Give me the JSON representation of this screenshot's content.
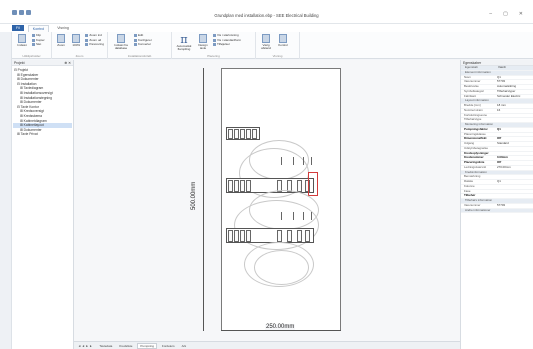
{
  "window": {
    "title": "Grundplan med installation.ebp - SEE Electrical Building",
    "controls": [
      "–",
      "▢",
      "✕"
    ]
  },
  "ribbon_tabs": [
    {
      "label": "Fil"
    },
    {
      "label": "Kontrol"
    },
    {
      "label": "Visning"
    }
  ],
  "ribbon": {
    "groups": [
      {
        "label": "Udklipsholder",
        "items": [
          "Klip",
          "Kopier",
          "Indsæt",
          "Slet"
        ]
      },
      {
        "label": "Zoom",
        "items": [
          "Zoom",
          "100%",
          "Zoom ind",
          "Zoom ud",
          "Panorering"
        ]
      },
      {
        "label": "Installationsforløb",
        "items": [
          "Indsæt fra database",
          "Edit",
          "Konfigurer",
          "Konverter"
        ]
      },
      {
        "label": "Placering",
        "items": [
          "Automatisk flampiling",
          "Design tavle",
          "Tilføjelser"
        ]
      },
      {
        "label": "Visning",
        "items": [
          "Vis i startvisning",
          "Vis i standardform",
          "Vis i Isometrisk",
          "Vælg afstand",
          "Kontrol"
        ]
      }
    ]
  },
  "nav": {
    "title": "Projekt",
    "pin": "⊕ ✕",
    "items": [
      {
        "label": "⊟ Projekt",
        "indent": 0
      },
      {
        "label": "⊞ Egenskaber",
        "indent": 1
      },
      {
        "label": "⊞ Dokumenter",
        "indent": 1
      },
      {
        "label": "⊟ Installation",
        "indent": 1
      },
      {
        "label": "⊞ Tavlediagram",
        "indent": 2
      },
      {
        "label": "⊞ Installationsoversigt",
        "indent": 2
      },
      {
        "label": "⊞ Installationstegning",
        "indent": 2
      },
      {
        "label": "⊞ Dokumenter",
        "indent": 2
      },
      {
        "label": "⊟ Tavle Kontor",
        "indent": 1
      },
      {
        "label": "⊞ Kredsoversigt",
        "indent": 2
      },
      {
        "label": "⊞ Kredsskema",
        "indent": 2
      },
      {
        "label": "⊞ Kabinetdiagram",
        "indent": 2
      },
      {
        "label": "⊞ Kabinetlayout",
        "indent": 2,
        "selected": true
      },
      {
        "label": "⊞ Dokumenter",
        "indent": 2
      },
      {
        "label": "⊞ Tavle Privat",
        "indent": 1
      }
    ]
  },
  "drawing": {
    "vertical_dim": "500.00mm",
    "horizontal_dim": "250.00mm"
  },
  "sheet_tabs": [
    {
      "label": "◄ ◄ ► ►"
    },
    {
      "label": "Tavledata"
    },
    {
      "label": "Kredsliste"
    },
    {
      "label": "Pumpning"
    },
    {
      "label": "Fordelers"
    },
    {
      "label": "Ark"
    }
  ],
  "props": {
    "title": "Egenskaber",
    "rows": [
      {
        "k": "Egenskab",
        "v": "Værdi",
        "type": "section"
      },
      {
        "k": "Element information",
        "v": "",
        "type": "section"
      },
      {
        "k": "Navn",
        "v": "Q1",
        "type": ""
      },
      {
        "k": "Varenummer",
        "v": "57703",
        "type": ""
      },
      {
        "k": "Beskrivelse",
        "v": "Automatsikring",
        "type": ""
      },
      {
        "k": "Symbolkategori",
        "v": "Tilbehørstyper",
        "type": ""
      },
      {
        "k": "Fabrikant",
        "v": "Schneider Electric",
        "type": ""
      },
      {
        "k": "Layout information",
        "v": "",
        "type": "section"
      },
      {
        "k": "Bredde [mm]",
        "v": "18 mm",
        "type": ""
      },
      {
        "k": "Nominel strøm",
        "v": "16",
        "type": ""
      },
      {
        "k": "Kortslutningsevne",
        "v": "",
        "type": ""
      },
      {
        "k": "Tilbehørstype",
        "v": "",
        "type": ""
      },
      {
        "k": "Montering information",
        "v": "",
        "type": "section"
      },
      {
        "k": "Pumpningsfaktor",
        "v": "Q1",
        "type": "hl"
      },
      {
        "k": "Placeringsklasse",
        "v": "",
        "type": ""
      },
      {
        "k": "Dimensioneffekt",
        "v": "Off",
        "type": "hl"
      },
      {
        "k": "Udgang",
        "v": "Standard",
        "type": ""
      },
      {
        "k": "Udstyrsbetegnelse",
        "v": "",
        "type": ""
      },
      {
        "k": "Kredsoplysninger",
        "v": "",
        "type": "hl"
      },
      {
        "k": "Kredsnummer",
        "v": "0.00mm",
        "type": "hl"
      },
      {
        "k": "Placeringslinie",
        "v": "Off",
        "type": "hl"
      },
      {
        "k": "Ledningstværsnit",
        "v": "270.00mm",
        "type": ""
      },
      {
        "k": "Kredsinformation",
        "v": "",
        "type": "section"
      },
      {
        "k": "Bemærkning",
        "v": "",
        "type": ""
      },
      {
        "k": "Række",
        "v": "Q1",
        "type": ""
      },
      {
        "k": "Kolonne",
        "v": "",
        "type": ""
      },
      {
        "k": "Fase",
        "v": "",
        "type": ""
      },
      {
        "k": "Tilbehør",
        "v": "",
        "type": "hl"
      },
      {
        "k": "Tilbehørs information",
        "v": "",
        "type": "section"
      },
      {
        "k": "Varenummer",
        "v": "57703",
        "type": ""
      },
      {
        "k": "Andre informationer",
        "v": "",
        "type": "section"
      }
    ]
  }
}
